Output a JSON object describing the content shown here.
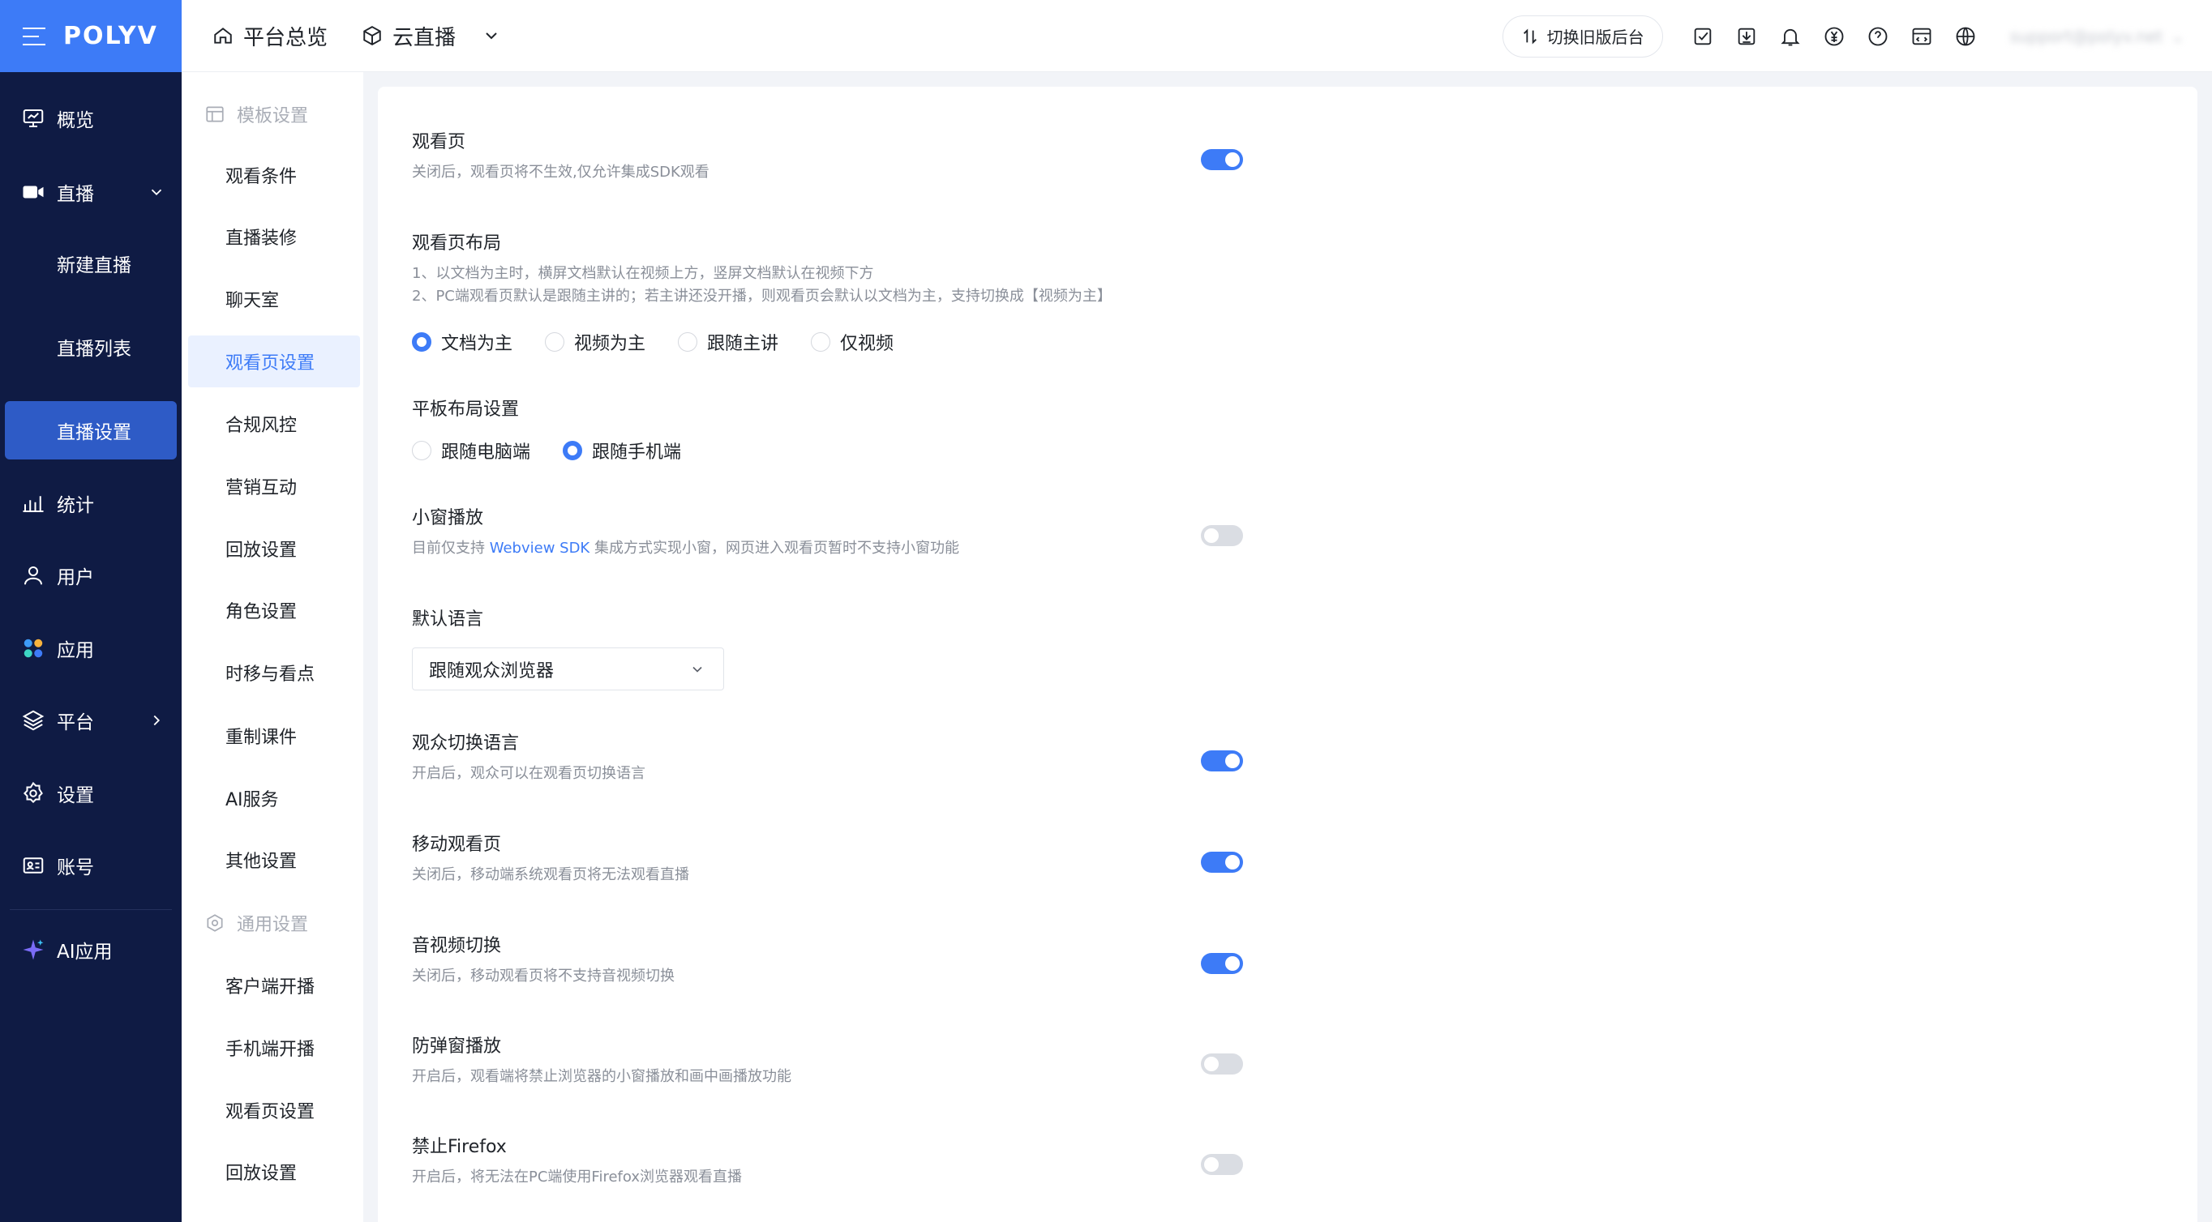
{
  "brand": {
    "logo_text": "POLYV"
  },
  "header": {
    "crumbs": [
      {
        "label": "平台总览",
        "icon": "home-icon"
      },
      {
        "label": "云直播",
        "icon": "cube-icon"
      }
    ],
    "switch_label": "切换旧版后台",
    "user_name": "support@polyv.net"
  },
  "nav": {
    "items": [
      {
        "label": "概览",
        "icon": "monitor-icon"
      },
      {
        "label": "直播",
        "icon": "video-camera-icon"
      },
      {
        "label": "统计",
        "icon": "bar-chart-icon"
      },
      {
        "label": "用户",
        "icon": "user-icon"
      },
      {
        "label": "应用",
        "icon": "apps-icon"
      },
      {
        "label": "平台",
        "icon": "layers-icon"
      },
      {
        "label": "设置",
        "icon": "settings-icon"
      },
      {
        "label": "账号",
        "icon": "id-card-icon"
      },
      {
        "label": "AI应用",
        "icon": "sparkle-icon"
      }
    ],
    "live_sub": [
      "新建直播",
      "直播列表",
      "直播设置"
    ]
  },
  "subnav": {
    "group1": "模板设置",
    "group1_items": [
      "观看条件",
      "直播装修",
      "聊天室",
      "观看页设置",
      "合规风控",
      "营销互动",
      "回放设置",
      "角色设置",
      "时移与看点",
      "重制课件",
      "AI服务",
      "其他设置"
    ],
    "group2": "通用设置",
    "group2_items": [
      "客户端开播",
      "手机端开播",
      "观看页设置",
      "回放设置"
    ]
  },
  "settings": {
    "watch_page": {
      "title": "观看页",
      "desc": "关闭后，观看页将不生效,仅允许集成SDK观看",
      "enabled": true
    },
    "layout": {
      "title": "观看页布局",
      "desc1": "1、以文档为主时，横屏文档默认在视频上方，竖屏文档默认在视频下方",
      "desc2": "2、PC端观看页默认是跟随主讲的；若主讲还没开播，则观看页会默认以文档为主，支持切换成【视频为主】",
      "options": [
        "文档为主",
        "视频为主",
        "跟随主讲",
        "仅视频"
      ],
      "selected": "文档为主"
    },
    "tablet": {
      "title": "平板布局设置",
      "options": [
        "跟随电脑端",
        "跟随手机端"
      ],
      "selected": "跟随手机端"
    },
    "mini": {
      "title": "小窗播放",
      "desc_pre": "目前仅支持 ",
      "desc_link": "Webview SDK",
      "desc_post": " 集成方式实现小窗，网页进入观看页暂时不支持小窗功能",
      "enabled": false
    },
    "language": {
      "title": "默认语言",
      "value": "跟随观众浏览器"
    },
    "switch_lang": {
      "title": "观众切换语言",
      "desc": "开启后，观众可以在观看页切换语言",
      "enabled": true
    },
    "mobile": {
      "title": "移动观看页",
      "desc": "关闭后，移动端系统观看页将无法观看直播",
      "enabled": true
    },
    "av_switch": {
      "title": "音视频切换",
      "desc": "关闭后，移动观看页将不支持音视频切换",
      "enabled": true
    },
    "anti_popup": {
      "title": "防弹窗播放",
      "desc": "开启后，观看端将禁止浏览器的小窗播放和画中画播放功能",
      "enabled": false
    },
    "firefox": {
      "title": "禁止Firefox",
      "desc": "开启后，将无法在PC端使用Firefox浏览器观看直播",
      "enabled": false
    }
  }
}
